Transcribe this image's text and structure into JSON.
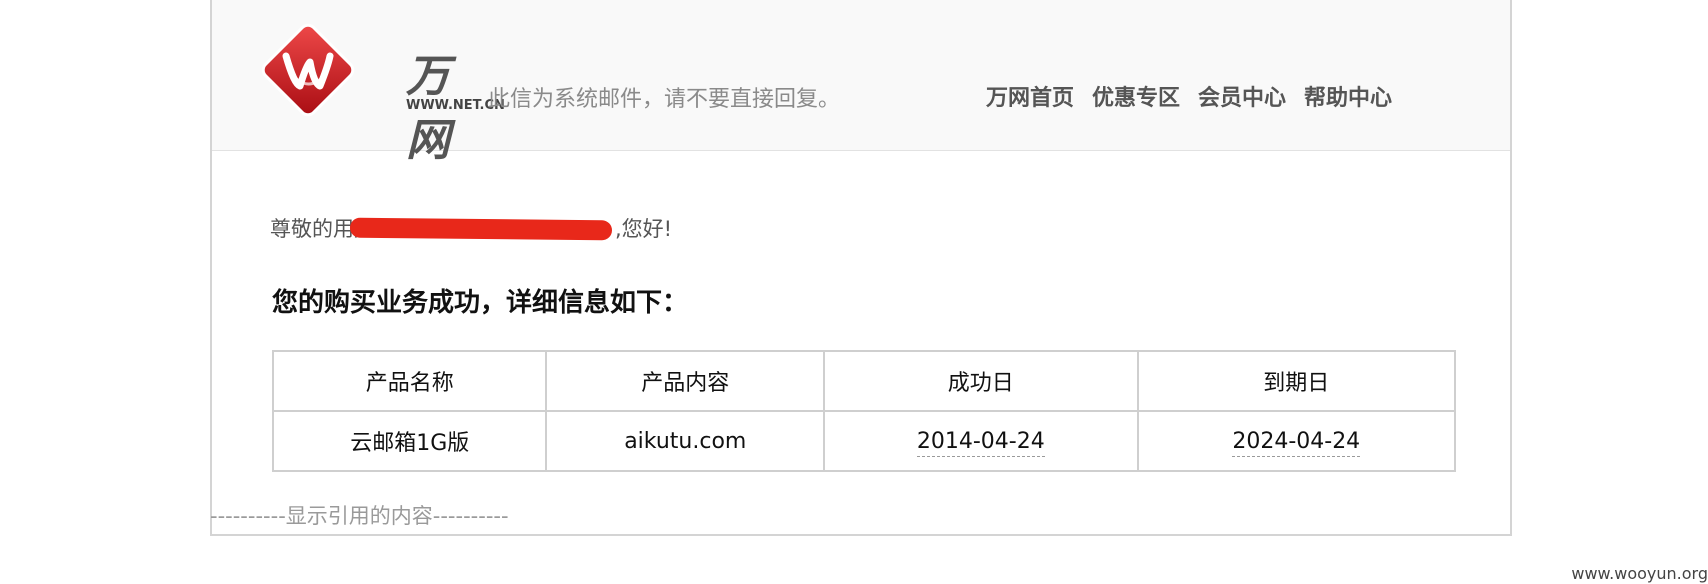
{
  "header": {
    "logo_text": "万网",
    "logo_domain": "WWW.NET.CN",
    "notice": "此信为系统邮件，请不要直接回复。",
    "nav": [
      "万网首页",
      "优惠专区",
      "会员中心",
      "帮助中心"
    ]
  },
  "greeting": {
    "prefix": "尊敬的用户",
    "suffix": ",您好!"
  },
  "headline": "您的购买业务成功，详细信息如下：",
  "table": {
    "headers": [
      "产品名称",
      "产品内容",
      "成功日",
      "到期日"
    ],
    "rows": [
      [
        "云邮箱1G版",
        "aikutu.com",
        "2014-04-24",
        "2024-04-24"
      ]
    ]
  },
  "quoted_toggle": "----------显示引用的内容----------",
  "watermark": "www.wooyun.org",
  "colors": {
    "logo_red": "#d8171d",
    "redaction": "#e8281a",
    "nav_text": "#555555"
  }
}
